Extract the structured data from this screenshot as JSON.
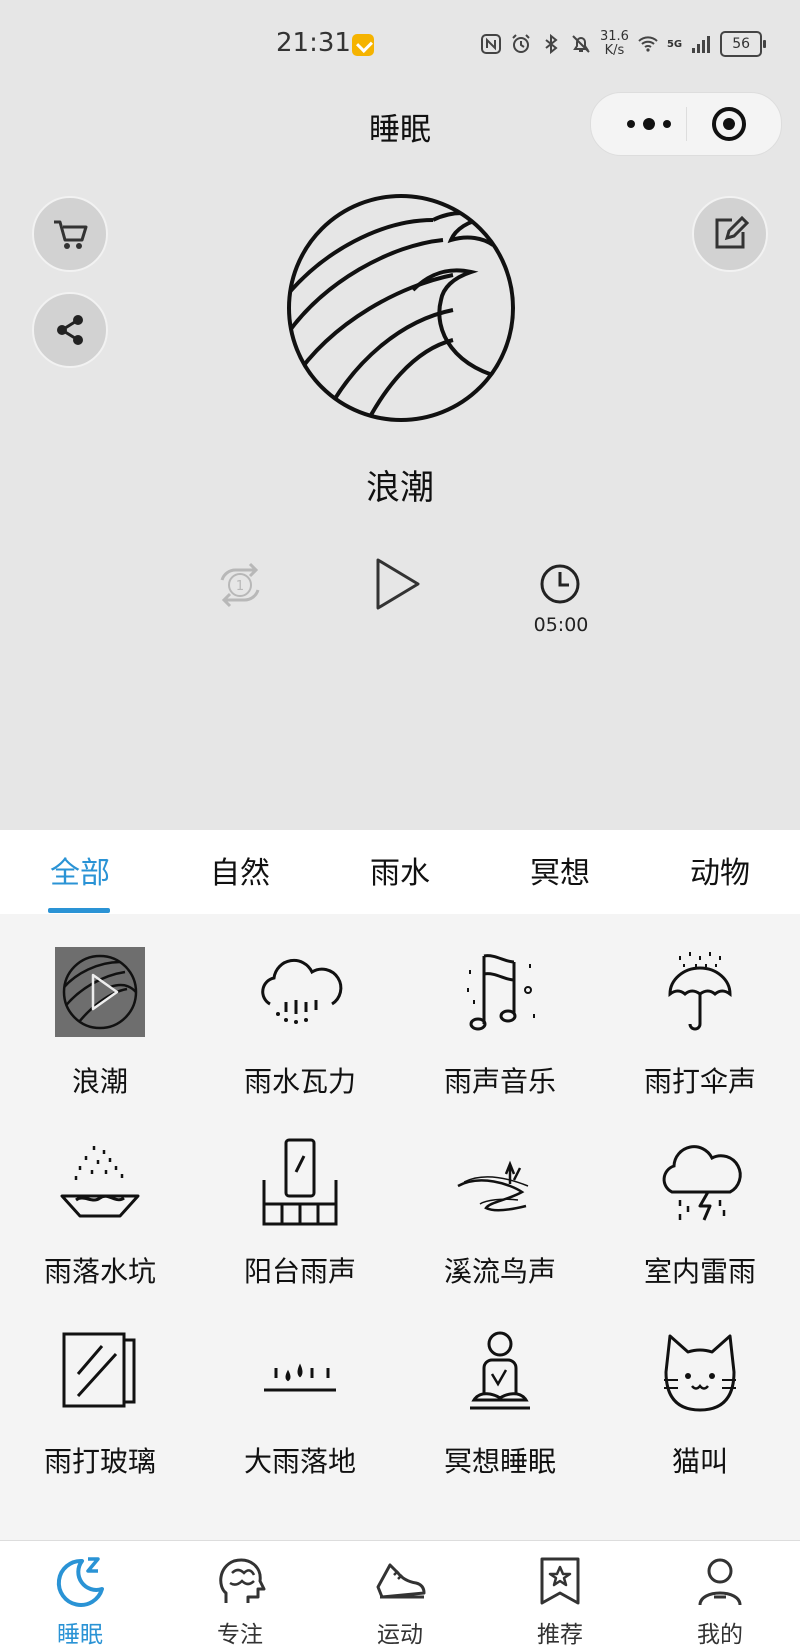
{
  "status_bar": {
    "time": "21:31",
    "net_speed_value": "31.6",
    "net_speed_unit": "K/s",
    "signal_label": "5G",
    "battery": "56"
  },
  "header": {
    "title": "睡眠"
  },
  "player": {
    "current_sound": "浪潮",
    "repeat_badge": "1",
    "timer": "05:00"
  },
  "tabs": [
    {
      "label": "全部",
      "active": true
    },
    {
      "label": "自然",
      "active": false
    },
    {
      "label": "雨水",
      "active": false
    },
    {
      "label": "冥想",
      "active": false
    },
    {
      "label": "动物",
      "active": false
    }
  ],
  "sounds": [
    {
      "label": "浪潮",
      "icon": "wave-icon",
      "selected": true
    },
    {
      "label": "雨水瓦力",
      "icon": "rain-cloud-icon"
    },
    {
      "label": "雨声音乐",
      "icon": "music-flag-icon"
    },
    {
      "label": "雨打伞声",
      "icon": "umbrella-icon"
    },
    {
      "label": "雨落水坑",
      "icon": "puddle-icon"
    },
    {
      "label": "阳台雨声",
      "icon": "balcony-icon"
    },
    {
      "label": "溪流鸟声",
      "icon": "stream-icon"
    },
    {
      "label": "室内雷雨",
      "icon": "thunder-cloud-icon"
    },
    {
      "label": "雨打玻璃",
      "icon": "glass-window-icon"
    },
    {
      "label": "大雨落地",
      "icon": "heavy-rain-icon"
    },
    {
      "label": "冥想睡眠",
      "icon": "meditation-icon"
    },
    {
      "label": "猫叫",
      "icon": "cat-icon"
    }
  ],
  "bottom_nav": [
    {
      "label": "睡眠",
      "icon": "moon-icon",
      "active": true
    },
    {
      "label": "专注",
      "icon": "brain-icon",
      "active": false
    },
    {
      "label": "运动",
      "icon": "sneaker-icon",
      "active": false
    },
    {
      "label": "推荐",
      "icon": "star-bookmark-icon",
      "active": false
    },
    {
      "label": "我的",
      "icon": "user-icon",
      "active": false
    }
  ],
  "colors": {
    "accent": "#2a93d5",
    "background": "#e6e6e6",
    "grid_background": "#f4f4f4"
  }
}
